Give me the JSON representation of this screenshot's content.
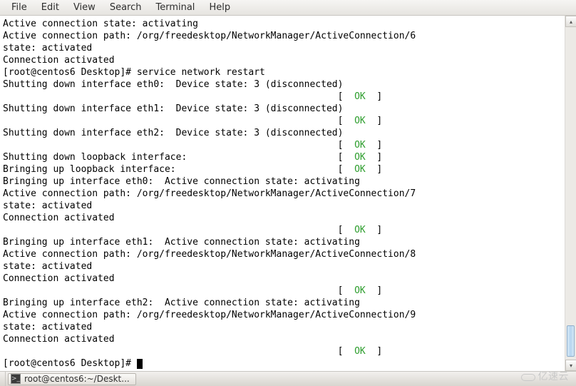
{
  "menubar": {
    "items": [
      "File",
      "Edit",
      "View",
      "Search",
      "Terminal",
      "Help"
    ]
  },
  "prompt": "[root@centos6 Desktop]# ",
  "ok_label": "OK",
  "terminal": [
    {
      "t": "plain",
      "text": "Active connection state: activating"
    },
    {
      "t": "plain",
      "text": "Active connection path: /org/freedesktop/NetworkManager/ActiveConnection/6"
    },
    {
      "t": "plain",
      "text": "state: activated"
    },
    {
      "t": "plain",
      "text": "Connection activated"
    },
    {
      "t": "cmd",
      "text": "service network restart"
    },
    {
      "t": "plain",
      "text": "Shutting down interface eth0:  Device state: 3 (disconnected)"
    },
    {
      "t": "ok"
    },
    {
      "t": "plain",
      "text": "Shutting down interface eth1:  Device state: 3 (disconnected)"
    },
    {
      "t": "ok"
    },
    {
      "t": "plain",
      "text": "Shutting down interface eth2:  Device state: 3 (disconnected)"
    },
    {
      "t": "ok"
    },
    {
      "t": "okline",
      "text": "Shutting down loopback interface:  "
    },
    {
      "t": "okline",
      "text": "Bringing up loopback interface:  "
    },
    {
      "t": "plain",
      "text": "Bringing up interface eth0:  Active connection state: activating"
    },
    {
      "t": "plain",
      "text": "Active connection path: /org/freedesktop/NetworkManager/ActiveConnection/7"
    },
    {
      "t": "plain",
      "text": "state: activated"
    },
    {
      "t": "plain",
      "text": "Connection activated"
    },
    {
      "t": "ok"
    },
    {
      "t": "plain",
      "text": "Bringing up interface eth1:  Active connection state: activating"
    },
    {
      "t": "plain",
      "text": "Active connection path: /org/freedesktop/NetworkManager/ActiveConnection/8"
    },
    {
      "t": "plain",
      "text": "state: activated"
    },
    {
      "t": "plain",
      "text": "Connection activated"
    },
    {
      "t": "ok"
    },
    {
      "t": "plain",
      "text": "Bringing up interface eth2:  Active connection state: activating"
    },
    {
      "t": "plain",
      "text": "Active connection path: /org/freedesktop/NetworkManager/ActiveConnection/9"
    },
    {
      "t": "plain",
      "text": "state: activated"
    },
    {
      "t": "plain",
      "text": "Connection activated"
    },
    {
      "t": "ok"
    },
    {
      "t": "prompt"
    }
  ],
  "ok_col": 60,
  "taskbar": {
    "item_label": "root@centos6:~/Deskt..."
  },
  "watermark": "亿速云"
}
